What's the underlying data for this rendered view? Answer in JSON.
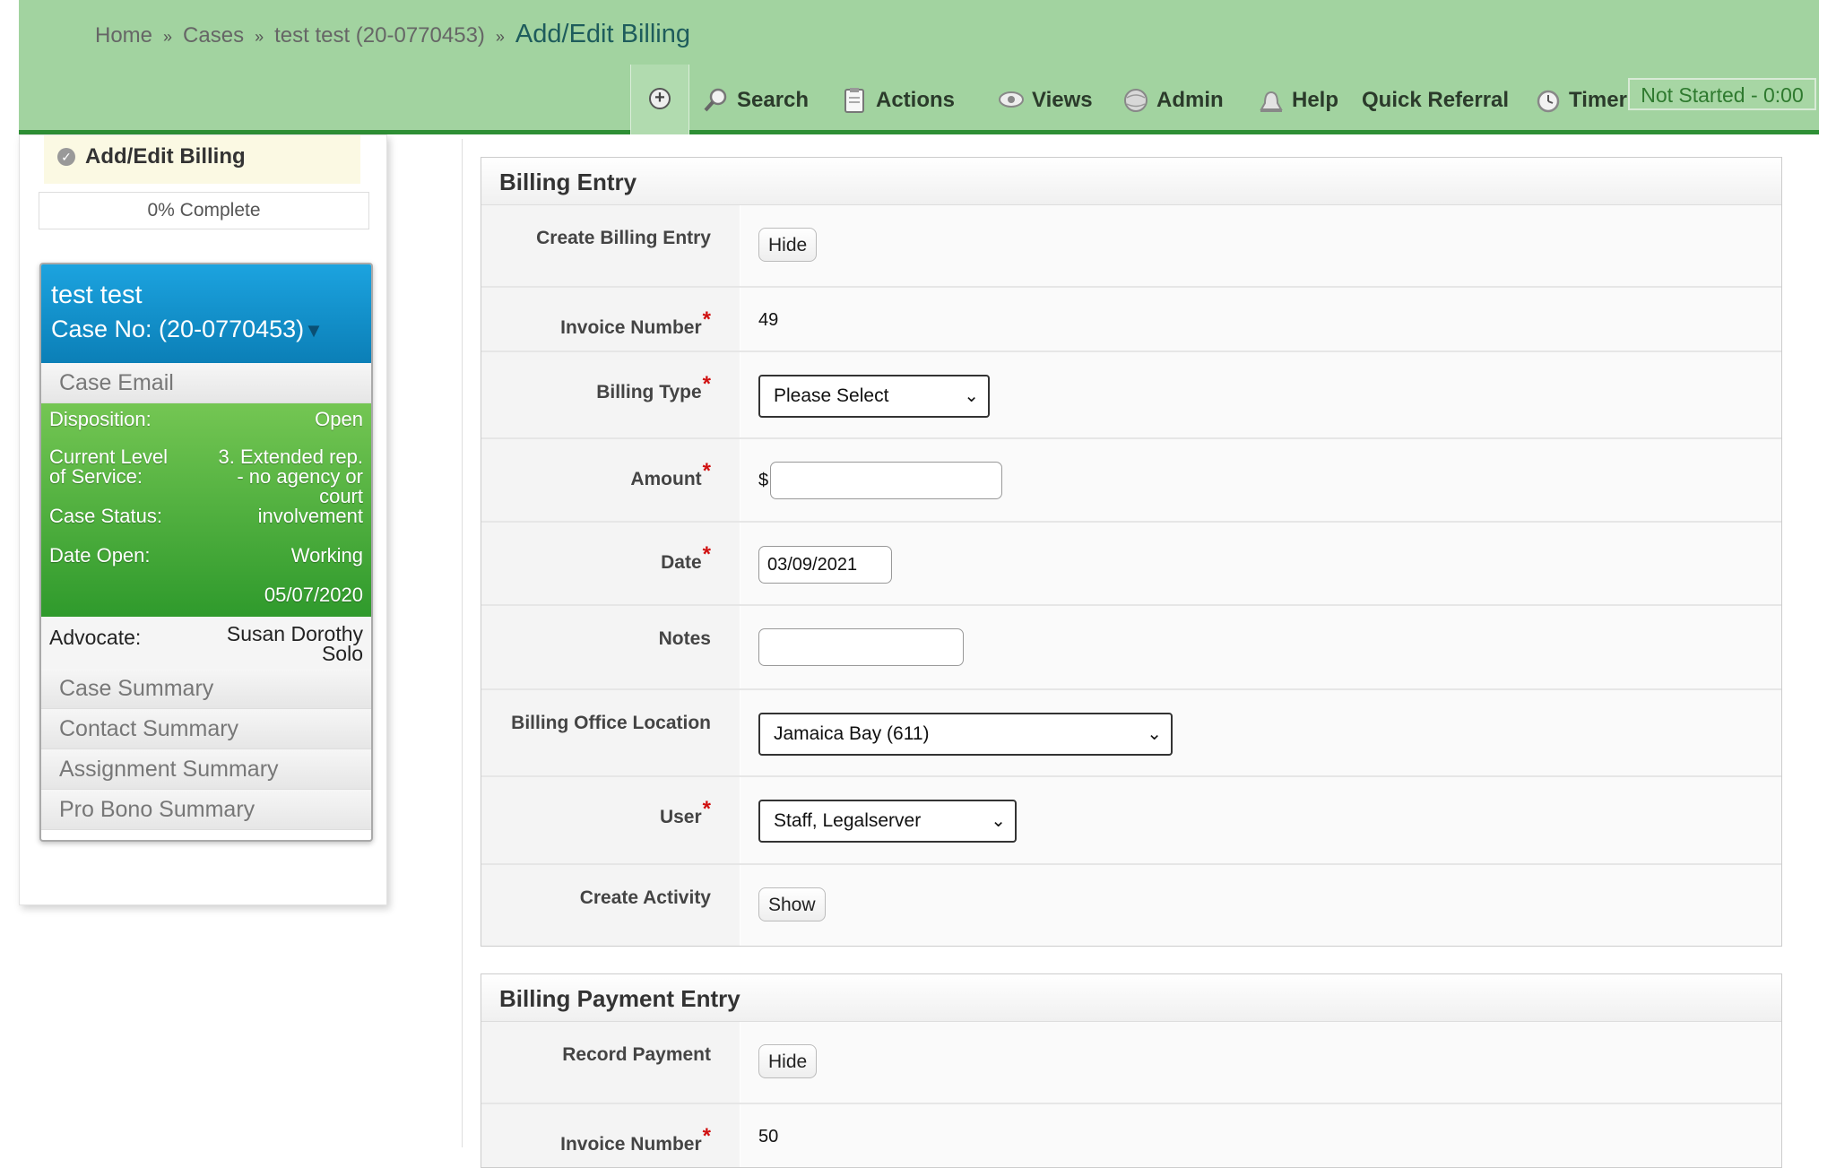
{
  "breadcrumb": {
    "home": "Home",
    "cases": "Cases",
    "case": "test test (20-0770453)",
    "current": "Add/Edit Billing",
    "separator": "»"
  },
  "nav": {
    "search": "Search",
    "actions": "Actions",
    "views": "Views",
    "admin": "Admin",
    "help": "Help",
    "quick_referral": "Quick Referral",
    "timer": "Timer",
    "timer_status": "Not Started - 0:00"
  },
  "sidebar": {
    "step": "Add/Edit Billing",
    "progress": "0% Complete",
    "case_name": "test test",
    "case_no": "Case No: (20-0770453)",
    "case_email": "Case Email",
    "disposition_label": "Disposition:",
    "disposition_value": "Open",
    "level_label_1": "Current Level",
    "level_label_2": "of Service:",
    "level_value_1": "3. Extended rep.",
    "level_value_2": "- no agency or",
    "level_value_3": "court",
    "level_value_4": "involvement",
    "status_label": "Case Status:",
    "status_value": "Working",
    "date_open_label": "Date Open:",
    "date_open_value": "05/07/2020",
    "advocate_label": "Advocate:",
    "advocate_value_1": "Susan Dorothy",
    "advocate_value_2": "Solo",
    "links": [
      "Case Summary",
      "Contact Summary",
      "Assignment Summary",
      "Pro Bono Summary"
    ]
  },
  "billing_entry": {
    "title": "Billing Entry",
    "create_label": "Create Billing Entry",
    "create_btn": "Hide",
    "invoice_label": "Invoice Number",
    "invoice_value": "49",
    "type_label": "Billing Type",
    "type_value": "Please Select",
    "amount_label": "Amount",
    "currency": "$",
    "amount_value": "",
    "date_label": "Date",
    "date_value": "03/09/2021",
    "notes_label": "Notes",
    "notes_value": "",
    "office_label": "Billing Office Location",
    "office_value": "Jamaica Bay (611)",
    "user_label": "User",
    "user_value": "Staff, Legalserver",
    "activity_label": "Create Activity",
    "activity_btn": "Show",
    "required_mark": "*"
  },
  "payment_entry": {
    "title": "Billing Payment Entry",
    "record_label": "Record Payment",
    "record_btn": "Hide",
    "invoice_label": "Invoice Number",
    "invoice_value": "50"
  },
  "colors": {
    "header_bg": "#a2d3a0",
    "header_accent": "#2e8f35",
    "case_header": "#0b7fb7",
    "case_details": "#3fa535",
    "required": "#d01010"
  }
}
